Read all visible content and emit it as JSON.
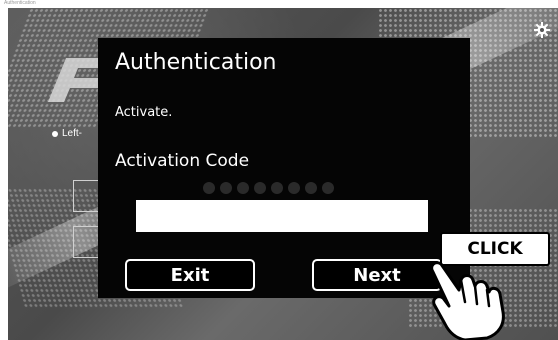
{
  "window": {
    "title_text": "Authentication"
  },
  "background": {
    "left_option_label": "Left-"
  },
  "dialog": {
    "title": "Authentication",
    "message": "Activate.",
    "code_label": "Activation Code",
    "code_value": "",
    "exit_label": "Exit",
    "next_label": "Next"
  },
  "annotation": {
    "callout_text": "CLICK"
  },
  "colors": {
    "dialog_bg": "#050505",
    "text": "#ffffff",
    "app_bg": "#555555"
  },
  "icons": {
    "settings": "gear-icon",
    "loading": "loading-dots-icon",
    "pointer": "hand-pointer-icon"
  }
}
